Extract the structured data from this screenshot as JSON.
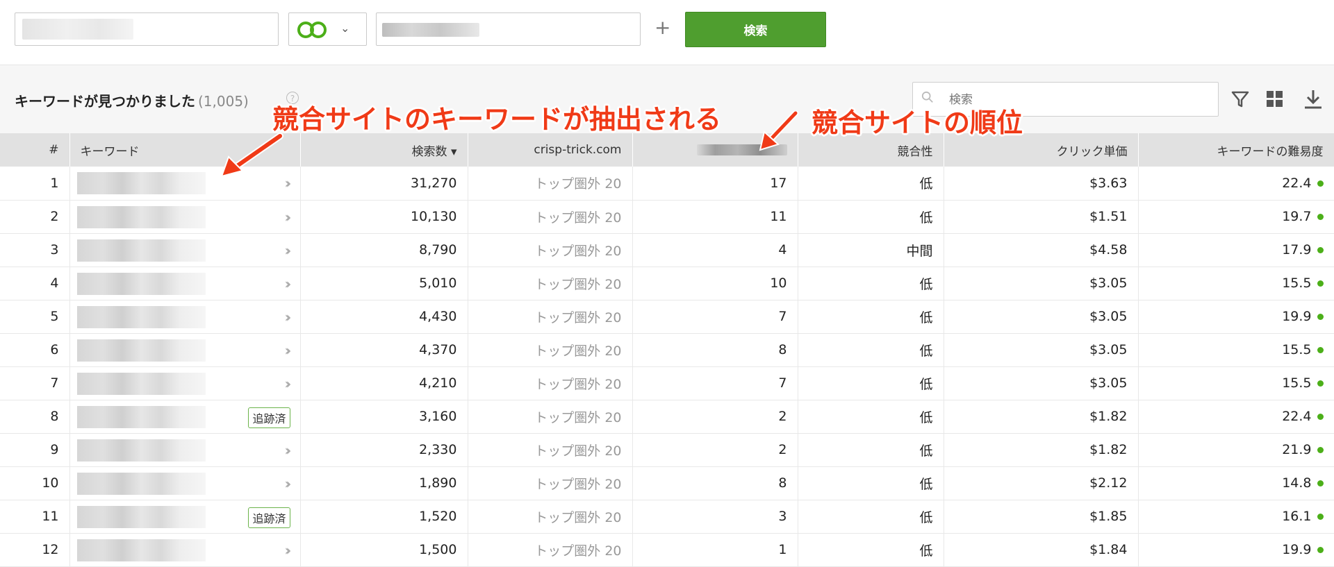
{
  "toolbar": {
    "search_button": "検索",
    "plus_label": "+"
  },
  "results": {
    "title": "キーワードが見つかりました",
    "count": "(1,005)",
    "help": "?",
    "search_placeholder": "検索"
  },
  "annotations": {
    "keywords_note": "競合サイトのキーワードが抽出される",
    "rank_note": "競合サイトの順位"
  },
  "table": {
    "headers": {
      "index": "#",
      "keyword": "キーワード",
      "volume": "検索数 ▾",
      "site": "crisp-trick.com",
      "competitor": "",
      "competition": "競合性",
      "cpc": "クリック単価",
      "difficulty": "キーワードの難易度"
    },
    "rows": [
      {
        "idx": "1",
        "tag": "",
        "volume": "31,270",
        "site": "トップ圏外 20",
        "rank": "17",
        "comp": "低",
        "cpc": "$3.63",
        "diff": "22.4"
      },
      {
        "idx": "2",
        "tag": "",
        "volume": "10,130",
        "site": "トップ圏外 20",
        "rank": "11",
        "comp": "低",
        "cpc": "$1.51",
        "diff": "19.7"
      },
      {
        "idx": "3",
        "tag": "",
        "volume": "8,790",
        "site": "トップ圏外 20",
        "rank": "4",
        "comp": "中間",
        "cpc": "$4.58",
        "diff": "17.9"
      },
      {
        "idx": "4",
        "tag": "",
        "volume": "5,010",
        "site": "トップ圏外 20",
        "rank": "10",
        "comp": "低",
        "cpc": "$3.05",
        "diff": "15.5"
      },
      {
        "idx": "5",
        "tag": "",
        "volume": "4,430",
        "site": "トップ圏外 20",
        "rank": "7",
        "comp": "低",
        "cpc": "$3.05",
        "diff": "19.9"
      },
      {
        "idx": "6",
        "tag": "",
        "volume": "4,370",
        "site": "トップ圏外 20",
        "rank": "8",
        "comp": "低",
        "cpc": "$3.05",
        "diff": "15.5"
      },
      {
        "idx": "7",
        "tag": "",
        "volume": "4,210",
        "site": "トップ圏外 20",
        "rank": "7",
        "comp": "低",
        "cpc": "$3.05",
        "diff": "15.5"
      },
      {
        "idx": "8",
        "tag": "追跡済",
        "volume": "3,160",
        "site": "トップ圏外 20",
        "rank": "2",
        "comp": "低",
        "cpc": "$1.82",
        "diff": "22.4"
      },
      {
        "idx": "9",
        "tag": "",
        "volume": "2,330",
        "site": "トップ圏外 20",
        "rank": "2",
        "comp": "低",
        "cpc": "$1.82",
        "diff": "21.9"
      },
      {
        "idx": "10",
        "tag": "",
        "volume": "1,890",
        "site": "トップ圏外 20",
        "rank": "8",
        "comp": "低",
        "cpc": "$2.12",
        "diff": "14.8"
      },
      {
        "idx": "11",
        "tag": "追跡済",
        "volume": "1,520",
        "site": "トップ圏外 20",
        "rank": "3",
        "comp": "低",
        "cpc": "$1.85",
        "diff": "16.1"
      },
      {
        "idx": "12",
        "tag": "",
        "volume": "1,500",
        "site": "トップ圏外 20",
        "rank": "1",
        "comp": "低",
        "cpc": "$1.84",
        "diff": "19.9"
      }
    ]
  },
  "colors": {
    "accent_green": "#4f9e2f",
    "annotation_red": "#f03a17",
    "difficulty_dot": "#4caf19"
  },
  "icons": [
    "engine-logo-icon",
    "chevron-down-icon",
    "search-icon",
    "filter-icon",
    "grid-icon",
    "download-icon",
    "double-chevron-icon"
  ]
}
